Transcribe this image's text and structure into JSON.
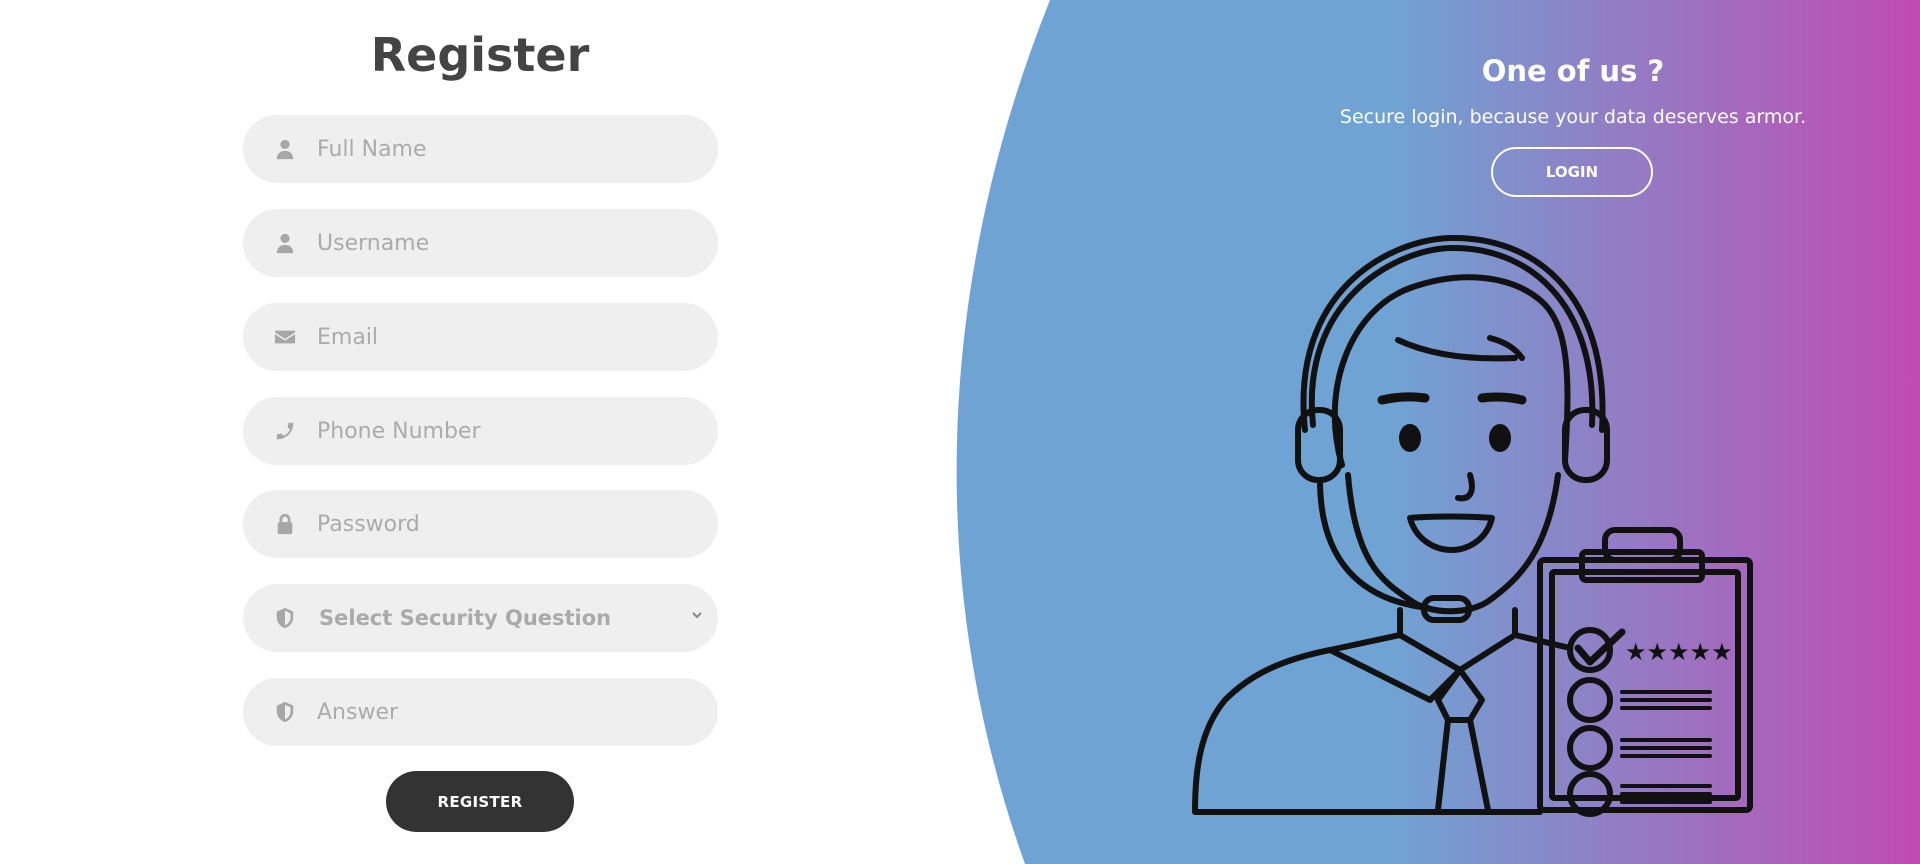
{
  "form": {
    "title": "Register",
    "fields": [
      {
        "placeholder": "Full Name",
        "icon": "user-icon"
      },
      {
        "placeholder": "Username",
        "icon": "user-icon"
      },
      {
        "placeholder": "Email",
        "icon": "envelope-icon"
      },
      {
        "placeholder": "Phone Number",
        "icon": "phone-icon"
      },
      {
        "placeholder": "Password",
        "icon": "lock-icon"
      },
      {
        "placeholder": "Select Security Question",
        "icon": "shield-icon",
        "type": "select"
      },
      {
        "placeholder": "Answer",
        "icon": "shield-icon"
      }
    ],
    "register_label": "REGISTER"
  },
  "panel": {
    "title": "One of us ?",
    "subtitle": "Secure login, because your data deserves armor.",
    "login_label": "LOGIN",
    "gradient_start": "#6fa3d3",
    "gradient_end": "#c04bb2",
    "illustration": "support-agent-with-clipboard"
  },
  "colors": {
    "field_bg": "#efefef",
    "button_dark": "#333333",
    "title_text": "#444444"
  }
}
